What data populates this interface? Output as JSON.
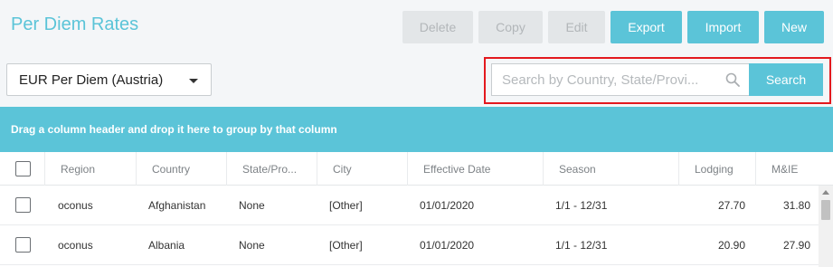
{
  "header": {
    "title": "Per Diem Rates"
  },
  "toolbar": {
    "delete": "Delete",
    "copy": "Copy",
    "edit": "Edit",
    "export": "Export",
    "import": "Import",
    "new": "New"
  },
  "filter": {
    "selected": "EUR Per Diem (Austria)"
  },
  "search": {
    "placeholder": "Search by Country, State/Provi...",
    "button": "Search"
  },
  "groupbar": {
    "text": "Drag a column header and drop it here to group by that column"
  },
  "table": {
    "columns": [
      "Region",
      "Country",
      "State/Pro...",
      "City",
      "Effective Date",
      "Season",
      "Lodging",
      "M&IE"
    ],
    "rows": [
      [
        "oconus",
        "Afghanistan",
        "None",
        "[Other]",
        "01/01/2020",
        "1/1 - 12/31",
        "27.70",
        "31.80"
      ],
      [
        "oconus",
        "Albania",
        "None",
        "[Other]",
        "01/01/2020",
        "1/1 - 12/31",
        "20.90",
        "27.90"
      ]
    ]
  },
  "colors": {
    "accent": "#5bc4d8",
    "highlight_border": "#e3191e",
    "disabled_bg": "#e3e6e8"
  }
}
